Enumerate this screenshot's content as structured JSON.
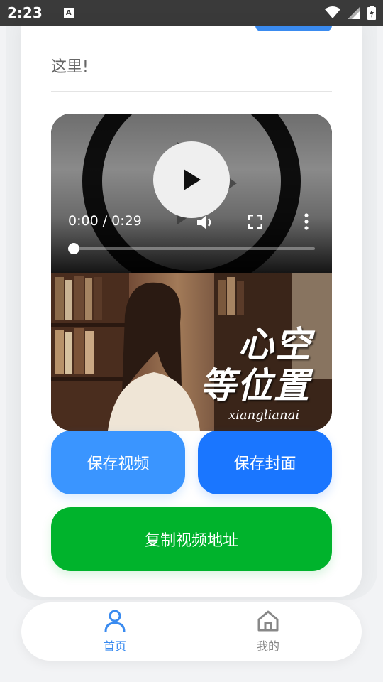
{
  "status_bar": {
    "time": "2:23",
    "notification_icon": "A"
  },
  "content": {
    "top_text": "这里!"
  },
  "video": {
    "time_label": "0:00 / 0:29",
    "progress": 0.0,
    "cover_title_line1": "心空",
    "cover_title_line2": "等位置",
    "cover_subtitle": "xianglianai"
  },
  "buttons": {
    "save_video": "保存视频",
    "save_cover": "保存封面",
    "copy_url": "复制视频地址"
  },
  "tabbar": {
    "home_label": "首页",
    "mine_label": "我的"
  },
  "colors": {
    "accent_blue": "#3a8bf0",
    "save_video_bg": "#3a95ff",
    "save_cover_bg": "#1a76ff",
    "copy_bg": "#00b32c"
  }
}
